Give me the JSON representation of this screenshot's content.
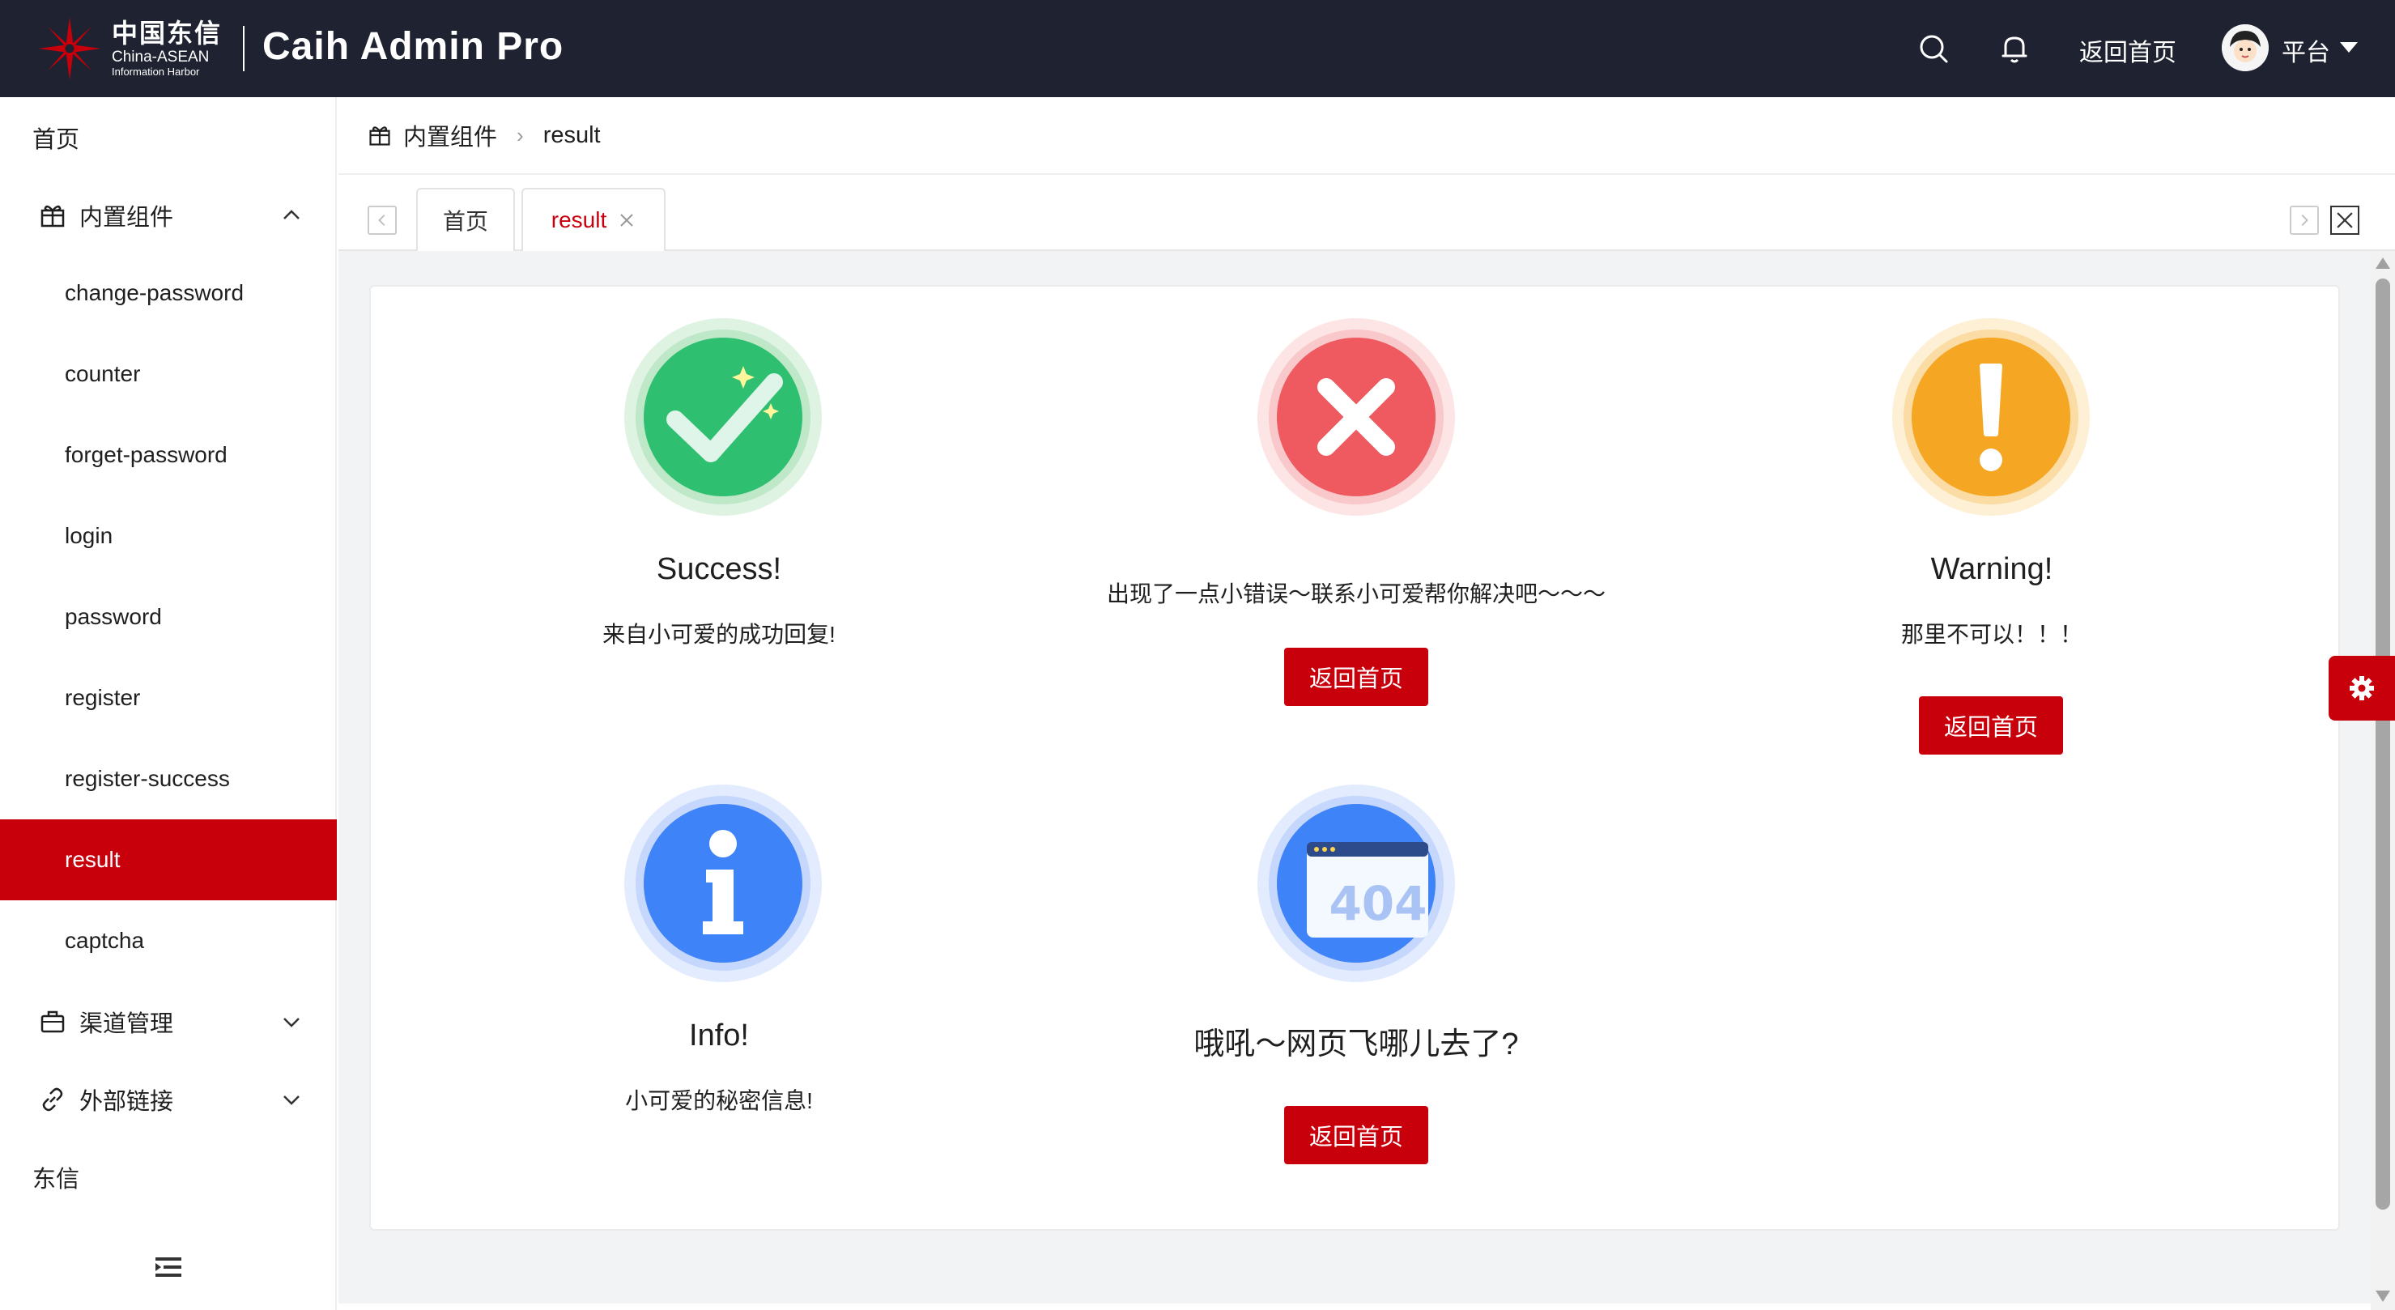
{
  "header": {
    "logo": {
      "cn": "中国东信",
      "en": "China-ASEAN",
      "en2": "Information Harbor"
    },
    "title": "Caih Admin Pro",
    "home_link": "返回首页",
    "user_name": "平台",
    "icons": [
      "search-icon",
      "bell-icon",
      "chevron-down-icon"
    ]
  },
  "sidebar": {
    "home": "首页",
    "builtin_group": "内置组件",
    "builtin_items": [
      "change-password",
      "counter",
      "forget-password",
      "login",
      "password",
      "register",
      "register-success",
      "result",
      "captcha"
    ],
    "active_item": "result",
    "channel_group": "渠道管理",
    "links_group": "外部链接",
    "dongxin": "东信",
    "collapse_icon": "menu-fold-icon"
  },
  "breadcrumb": {
    "root": "内置组件",
    "current": "result"
  },
  "tabs": [
    {
      "label": "首页",
      "active": false
    },
    {
      "label": "result",
      "active": true,
      "closable": true
    }
  ],
  "results": {
    "success": {
      "title": "Success!",
      "subtitle": "来自小可爱的成功回复!"
    },
    "error": {
      "subtitle": "出现了一点小错误～联系小可爱帮你解决吧～～～",
      "button": "返回首页"
    },
    "warning": {
      "title": "Warning!",
      "subtitle": "那里不可以！！！",
      "button": "返回首页"
    },
    "info": {
      "title": "Info!",
      "subtitle": "小可爱的秘密信息!"
    },
    "notfound": {
      "title": "哦吼～网页飞哪儿去了?",
      "button": "返回首页",
      "code": "404"
    }
  },
  "colors": {
    "accent": "#c8000c",
    "header_bg": "#1f2230",
    "success": "#2fbf71",
    "error": "#ee5a5f",
    "warning": "#f5a623",
    "info": "#3f83f8"
  }
}
